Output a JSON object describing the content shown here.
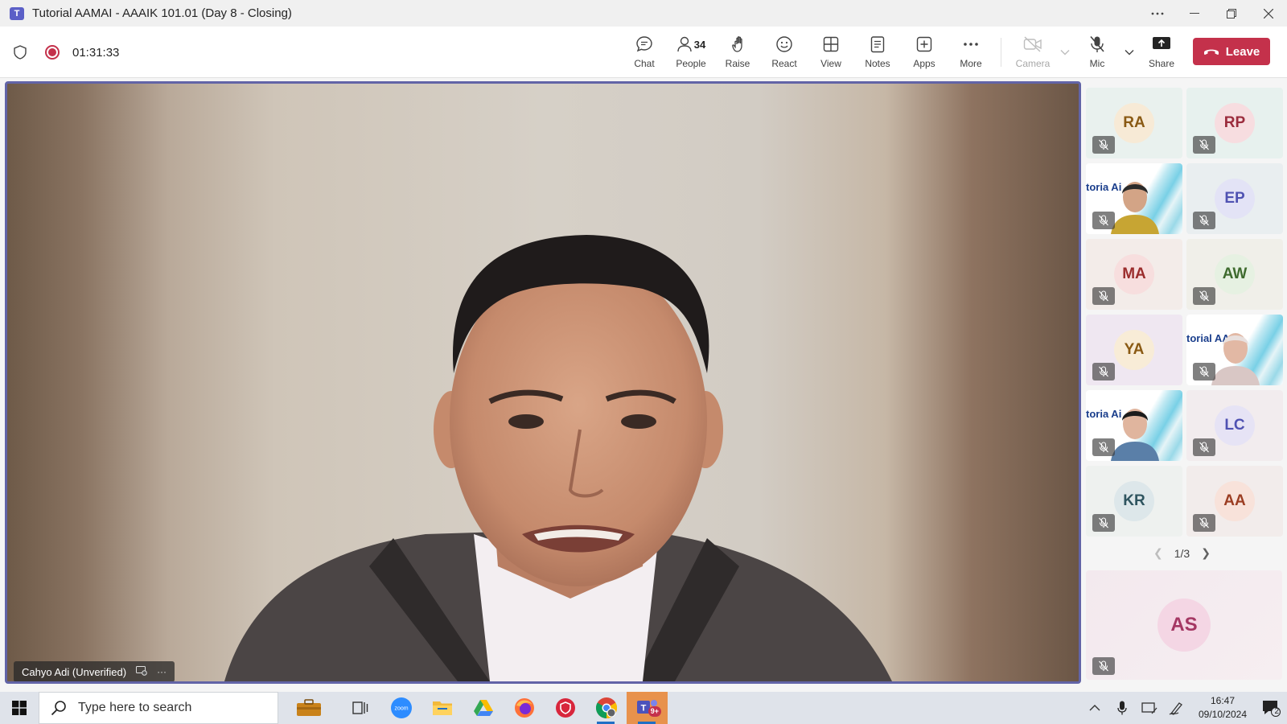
{
  "window": {
    "title": "Tutorial AAMAI - AAAIK 101.01 (Day 8 - Closing)",
    "controls": [
      "more",
      "minimize",
      "restore",
      "close"
    ]
  },
  "meeting": {
    "elapsed": "01:31:33",
    "actions": [
      {
        "name": "chat",
        "label": "Chat"
      },
      {
        "name": "people",
        "label": "People",
        "count": "34"
      },
      {
        "name": "raise",
        "label": "Raise"
      },
      {
        "name": "react",
        "label": "React"
      },
      {
        "name": "view",
        "label": "View"
      },
      {
        "name": "notes",
        "label": "Notes"
      },
      {
        "name": "apps",
        "label": "Apps"
      },
      {
        "name": "more",
        "label": "More"
      }
    ],
    "media": [
      {
        "name": "camera",
        "label": "Camera",
        "disabled": true
      },
      {
        "name": "mic",
        "label": "Mic"
      },
      {
        "name": "share",
        "label": "Share"
      }
    ],
    "leave_label": "Leave",
    "leave_color": "#c4314b",
    "accent": "#6264a7"
  },
  "stage": {
    "speaker_name": "Cahyo Adi (Unverified)",
    "more_glyph": "···"
  },
  "participants": {
    "tiles": [
      {
        "initials": "RA",
        "type": "avatar",
        "bg": "#e9f1ee",
        "circle": "#f7ead6",
        "fg": "#8a5a14"
      },
      {
        "initials": "RP",
        "type": "avatar",
        "bg": "#e7f1ee",
        "circle": "#f7dde0",
        "fg": "#9b2c3d"
      },
      {
        "initials": "",
        "type": "video",
        "slide": "toria  Ai"
      },
      {
        "initials": "EP",
        "type": "avatar",
        "bg": "#e9eef0",
        "circle": "#e3e3f6",
        "fg": "#4f52b2"
      },
      {
        "initials": "MA",
        "type": "avatar",
        "bg": "#f3ece9",
        "circle": "#f7dede",
        "fg": "#9b2c2c"
      },
      {
        "initials": "AW",
        "type": "avatar",
        "bg": "#f0efe9",
        "circle": "#e6f1e2",
        "fg": "#3e6b2e"
      },
      {
        "initials": "YA",
        "type": "avatar",
        "bg": "#efe7f1",
        "circle": "#f8ecd7",
        "fg": "#8a5a14"
      },
      {
        "initials": "",
        "type": "video",
        "slide": "torial AAM"
      },
      {
        "initials": "",
        "type": "video",
        "slide": "toria  Ai"
      },
      {
        "initials": "LC",
        "type": "avatar",
        "bg": "#f2ecee",
        "circle": "#e6e3f5",
        "fg": "#4f52b2"
      },
      {
        "initials": "KR",
        "type": "avatar",
        "bg": "#eef1ef",
        "circle": "#dde7ea",
        "fg": "#2f5560"
      },
      {
        "initials": "AA",
        "type": "avatar",
        "bg": "#f2eceb",
        "circle": "#f8e2da",
        "fg": "#9b3d22"
      }
    ],
    "page": "1/3",
    "featured": {
      "initials": "AS",
      "circle": "#f4d6e4",
      "fg": "#a43763"
    }
  },
  "taskbar": {
    "search_placeholder": "Type here to search",
    "apps": [
      "briefcase",
      "task-view",
      "zoom",
      "file-explorer",
      "google-drive",
      "firefox",
      "security",
      "chrome",
      "teams"
    ],
    "teams_badge": "9+",
    "time": "16:47",
    "date": "09/10/2024",
    "notification_count": "2"
  }
}
